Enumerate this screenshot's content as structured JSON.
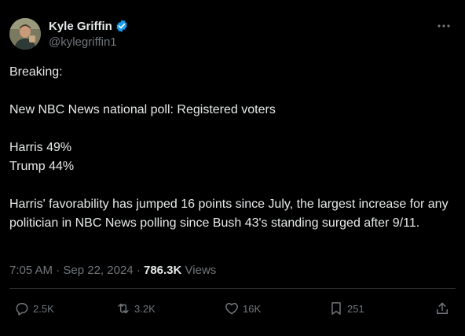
{
  "author": {
    "name": "Kyle Griffin",
    "handle": "@kylegriffin1",
    "verified_color": "#1d9bf0"
  },
  "tweet": {
    "lines": [
      "Breaking:",
      "",
      "New NBC News national poll: Registered voters",
      "",
      "Harris 49%",
      "Trump 44%",
      "",
      "Harris' favorability has jumped 16 points since July, the largest increase for any politician in NBC News polling since Bush 43's standing surged after 9/11."
    ],
    "time": "7:05 AM",
    "date": "Sep 22, 2024",
    "views_count": "786.3K",
    "views_label": "Views"
  },
  "actions": {
    "replies": "2.5K",
    "reposts": "3.2K",
    "likes": "16K",
    "bookmarks": "251"
  },
  "icons": {
    "more": "more-icon",
    "reply": "reply-icon",
    "repost": "repost-icon",
    "like": "heart-icon",
    "bookmark": "bookmark-icon",
    "share": "share-icon"
  }
}
